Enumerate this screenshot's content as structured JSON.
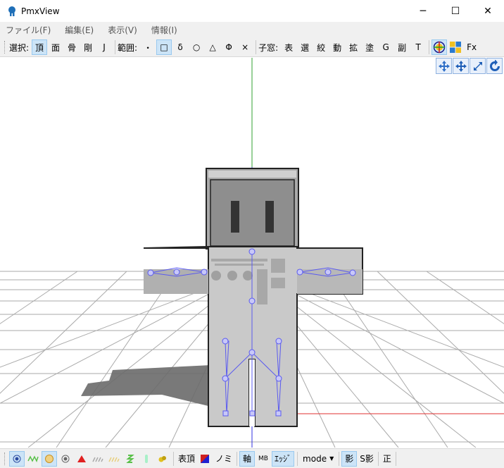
{
  "window": {
    "title": "PmxView",
    "minimize_glyph": "─",
    "maximize_glyph": "☐",
    "close_glyph": "✕"
  },
  "menu": {
    "file": "ファイル(F)",
    "edit": "編集(E)",
    "view": "表示(V)",
    "info": "情報(I)"
  },
  "toolbar": {
    "select_label": "選択:",
    "select_buttons": [
      "頂",
      "面",
      "骨",
      "剛",
      "J"
    ],
    "range_label": "範囲:",
    "range_buttons": [
      "・",
      "□",
      "δ",
      "○",
      "△",
      "Φ",
      "×"
    ],
    "child_label": "子窓:",
    "child_buttons": [
      "表",
      "選",
      "絞",
      "動",
      "拡",
      "塗",
      "G",
      "副",
      "T"
    ],
    "fx_label": "Fx"
  },
  "view_controls": [
    "move-icon",
    "pan-icon",
    "zoom-icon",
    "rotate-icon"
  ],
  "status": {
    "vertex_table": "表頂",
    "nomi": "ノミ",
    "axis": "軸",
    "mb": "MB",
    "edge": "ｴｯｼﾞ",
    "mode": "mode",
    "shadow": "影",
    "s_shadow": "S影",
    "positive": "正"
  },
  "colors": {
    "accent": "#cce4f7",
    "bone": "#5a5af0",
    "axis_red": "#e03030",
    "axis_green": "#30a030",
    "axis_blue": "#3030e0"
  }
}
